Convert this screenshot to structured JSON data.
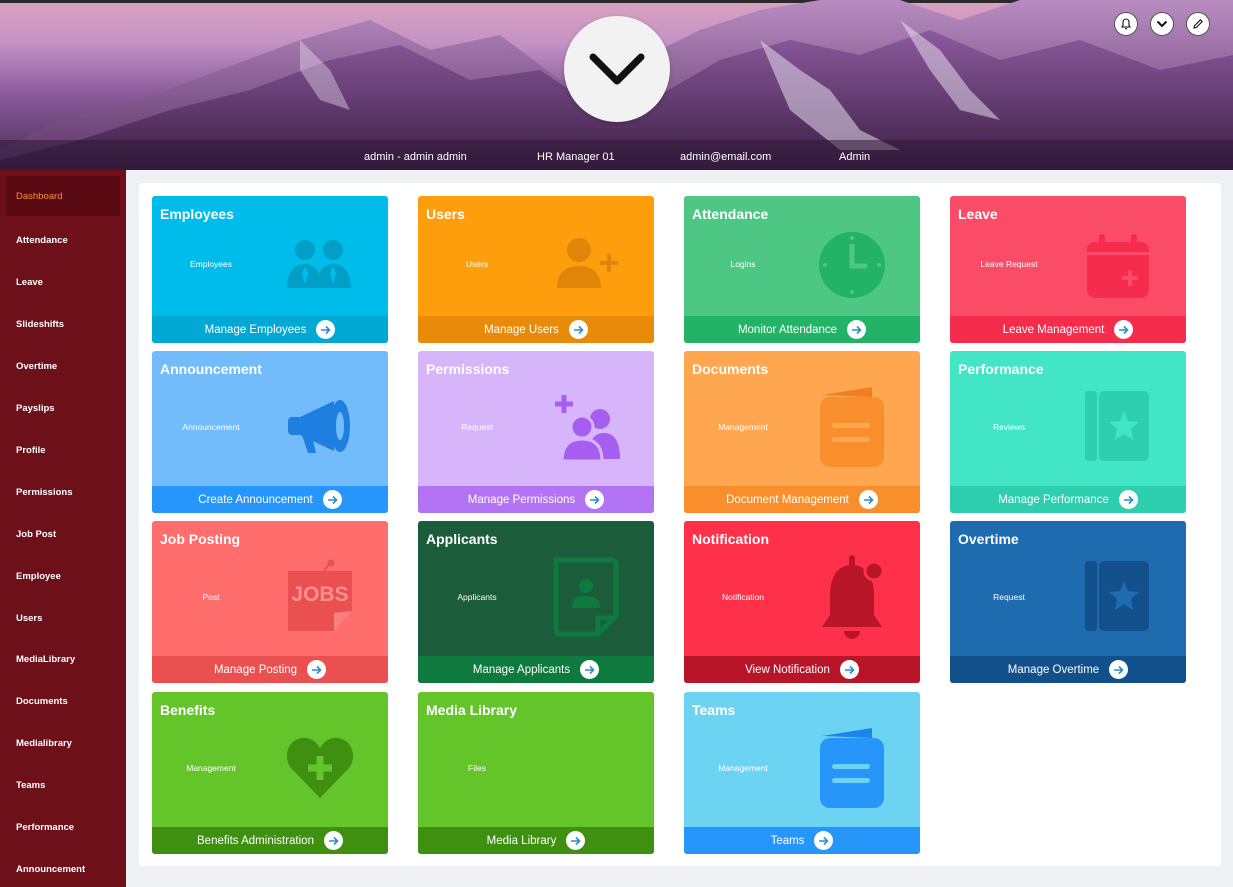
{
  "header": {
    "user_line": "admin - admin admin",
    "role_title": "HR Manager 01",
    "email": "admin@email.com",
    "role": "Admin",
    "icons": [
      "bell-icon",
      "chevron-down-icon",
      "pencil-icon"
    ]
  },
  "sidebar": {
    "items": [
      {
        "label": "Dashboard"
      },
      {
        "label": "Attendance"
      },
      {
        "label": "Leave"
      },
      {
        "label": "Slideshifts"
      },
      {
        "label": "Overtime"
      },
      {
        "label": "Payslips"
      },
      {
        "label": "Profile"
      },
      {
        "label": "Permissions"
      },
      {
        "label": "Job Post"
      },
      {
        "label": "Employee"
      },
      {
        "label": "Users"
      },
      {
        "label": "MediaLibrary"
      },
      {
        "label": "Documents"
      },
      {
        "label": "Medialibrary"
      },
      {
        "label": "Teams"
      },
      {
        "label": "Performance"
      },
      {
        "label": "Announcement"
      }
    ],
    "active_color": "#ff8a3d"
  },
  "cards": [
    {
      "title": "Employees",
      "sub": "Employees",
      "action": "Manage Employees",
      "icon": "people-icon",
      "color": "#00bcea",
      "foot_color": "#00a9d4"
    },
    {
      "title": "Users",
      "sub": "Users",
      "action": "Manage Users",
      "icon": "user-add-icon",
      "color": "#ff9e0d",
      "foot_color": "#e88b0a"
    },
    {
      "title": "Attendance",
      "sub": "Logins",
      "action": "Monitor Attendance",
      "icon": "clock-icon",
      "color": "#4fc784",
      "foot_color": "#22b366"
    },
    {
      "title": "Leave",
      "sub": "Leave Request",
      "action": "Leave Management",
      "icon": "calendar-add-icon",
      "color": "#fb4c67",
      "foot_color": "#f52c4b"
    },
    {
      "title": "Announcement",
      "sub": "Announcement",
      "action": "Create Announcement",
      "icon": "megaphone-icon",
      "color": "#72bcfc",
      "foot_color": "#2696fb"
    },
    {
      "title": "Permissions",
      "sub": "Request",
      "action": "Manage Permissions",
      "icon": "group-add-icon",
      "color": "#d6b5fb",
      "foot_color": "#b274f3"
    },
    {
      "title": "Documents",
      "sub": "Management",
      "action": "Document Management",
      "icon": "document-icon",
      "color": "#ffa650",
      "foot_color": "#f98f2c"
    },
    {
      "title": "Performance",
      "sub": "Reviews",
      "action": "Manage Performance",
      "icon": "star-book-icon",
      "color": "#42e6c6",
      "foot_color": "#2ecfae"
    },
    {
      "title": "Job Posting",
      "sub": "Post",
      "action": "Manage Posting",
      "icon": "jobs-note-icon",
      "color": "#ff6d6d",
      "foot_color": "#ea5050",
      "jobs_text": "JOBS"
    },
    {
      "title": "Applicants",
      "sub": "Applicants",
      "action": "Manage Applicants",
      "icon": "applicant-file-icon",
      "color": "#1b5c3a",
      "foot_color": "#0f7a3e"
    },
    {
      "title": "Notification",
      "sub": "Notification",
      "action": "View Notification",
      "icon": "bell-icon",
      "color": "#ff304a",
      "foot_color": "#b81628"
    },
    {
      "title": "Overtime",
      "sub": "Request",
      "action": "Manage Overtime",
      "icon": "star-book-icon",
      "color": "#1e6bb0",
      "foot_color": "#12508c"
    },
    {
      "title": "Benefits",
      "sub": "Management",
      "action": "Benefits Administration",
      "icon": "heart-plus-icon",
      "color": "#64c52b",
      "foot_color": "#3f8f10"
    },
    {
      "title": "Media Library",
      "sub": "Files",
      "action": "Media Library",
      "icon": "media-icon",
      "color": "#64c52b",
      "foot_color": "#3f8f10"
    },
    {
      "title": "Teams",
      "sub": "Management",
      "action": "Teams",
      "icon": "book-icon",
      "color": "#6dd3f3",
      "foot_color": "#2696fb"
    }
  ]
}
